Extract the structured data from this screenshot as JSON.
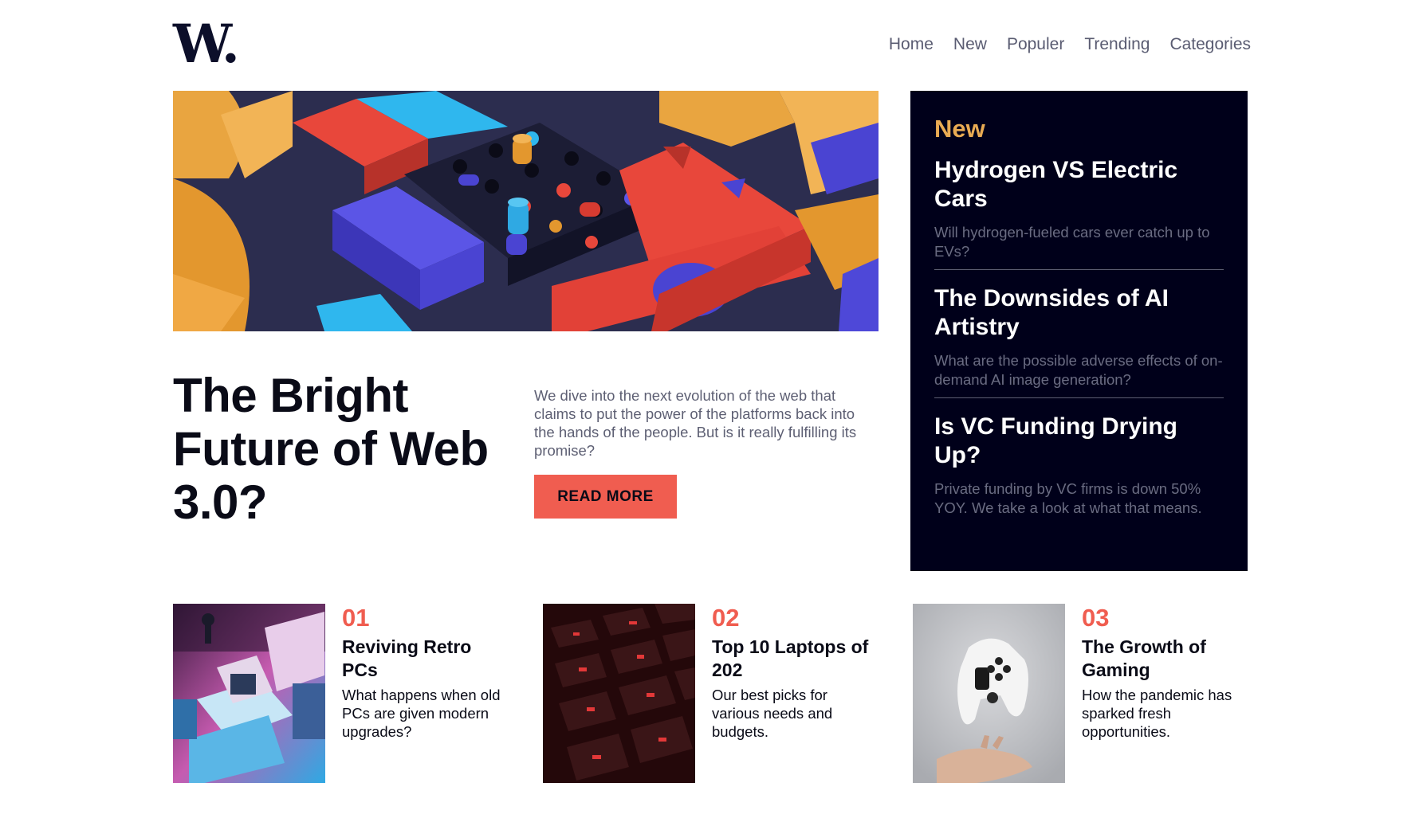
{
  "logo": {
    "text": "W",
    "dot": "."
  },
  "nav": [
    "Home",
    "New",
    "Populer",
    "Trending",
    "Categories"
  ],
  "hero": {
    "title": "The Bright Future of Web 3.0?",
    "description": "We dive into the next evolution of the web that claims to put the power of the platforms back into the hands of the people. But is it really fulfilling its promise?",
    "cta": "READ MORE"
  },
  "new_panel": {
    "heading": "New",
    "items": [
      {
        "title": "Hydrogen VS Electric Cars",
        "description": "Will hydrogen-fueled cars ever catch up to EVs?"
      },
      {
        "title": "The Downsides of AI Artistry",
        "description": "What are the possible adverse effects of on-demand AI image generation?"
      },
      {
        "title": "Is VC Funding Drying Up?",
        "description": "Private funding by VC firms is down 50% YOY. We take a look at what that means."
      }
    ]
  },
  "cards": [
    {
      "number": "01",
      "title": "Reviving Retro PCs",
      "description": "What happens when old PCs are given modern upgrades?",
      "image": "retro-pc-image"
    },
    {
      "number": "02",
      "title": "Top 10 Laptops of 202",
      "description": "Our best picks for various needs and budgets.",
      "image": "laptop-keyboard-image"
    },
    {
      "number": "03",
      "title": "The Growth of Gaming",
      "description": "How the pandemic has sparked fresh opportunities.",
      "image": "game-controller-image"
    }
  ],
  "colors": {
    "accent": "#f05d50",
    "new_heading": "#e9ab53",
    "panel_bg": "#00001a",
    "text_dark": "#0a0b17",
    "text_muted": "#5d5f73"
  }
}
